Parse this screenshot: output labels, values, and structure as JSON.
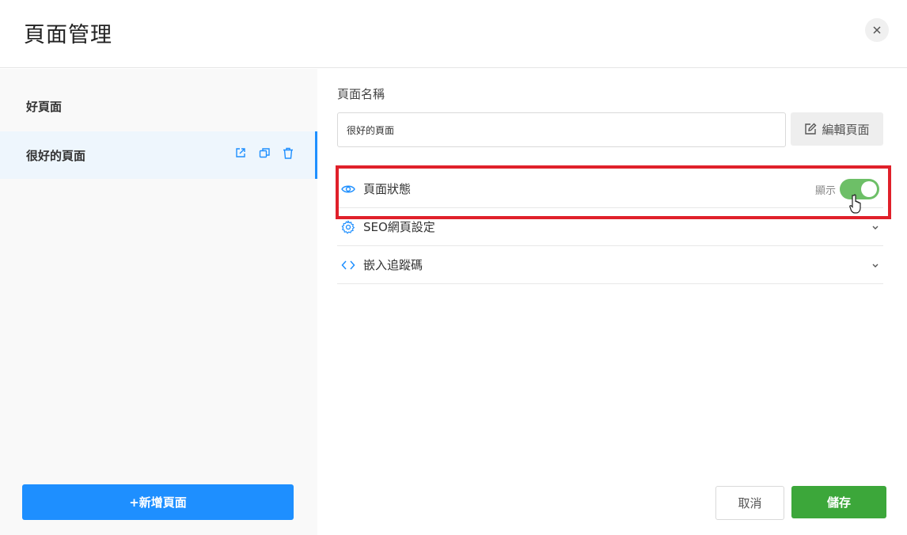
{
  "dialog": {
    "title": "頁面管理",
    "close_icon": "close-icon"
  },
  "sidebar": {
    "items": [
      {
        "label": "好頁面",
        "selected": false
      },
      {
        "label": "很好的頁面",
        "selected": true,
        "actions": [
          "external-link-icon",
          "duplicate-icon",
          "trash-icon"
        ]
      }
    ],
    "add_button_label": "+新增頁面"
  },
  "main": {
    "page_name_label": "頁面名稱",
    "page_name_value": "很好的頁面",
    "edit_button_label": "編輯頁面",
    "sections": [
      {
        "label": "頁面狀態",
        "icon": "eye-icon",
        "toggle_label": "顯示",
        "toggle_on": true
      },
      {
        "label": "SEO網頁設定",
        "icon": "gear-icon",
        "expandable": true
      },
      {
        "label": "嵌入追蹤碼",
        "icon": "code-icon",
        "expandable": true
      }
    ],
    "cancel_label": "取消",
    "save_label": "儲存"
  },
  "colors": {
    "primary": "#1e8fff",
    "success": "#3ca73a",
    "toggle_on": "#6dbf67",
    "highlight": "#e0202a",
    "icon": "#1e8fff"
  }
}
